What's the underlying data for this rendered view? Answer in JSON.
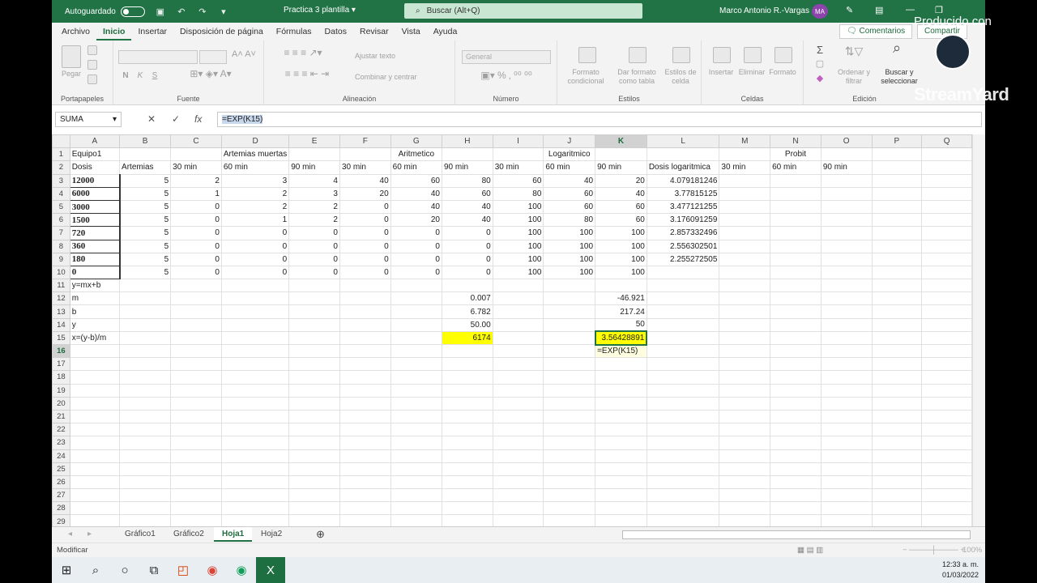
{
  "titlebar": {
    "autosave": "Autoguardado",
    "doc_title": "Practica 3 plantilla",
    "search": "Buscar (Alt+Q)",
    "user": "Marco Antonio R.-Vargas",
    "initials": "MA"
  },
  "menu": [
    "Archivo",
    "Inicio",
    "Insertar",
    "Disposición de página",
    "Fórmulas",
    "Datos",
    "Revisar",
    "Vista",
    "Ayuda"
  ],
  "menu_active": "Inicio",
  "comments": "Comentarios",
  "share": "Compartir",
  "ribbon": {
    "clipboard": {
      "label": "Portapapeles",
      "paste": "Pegar"
    },
    "font": {
      "label": "Fuente",
      "bold": "N",
      "italic": "K",
      "underline": "S"
    },
    "align": {
      "label": "Alineación",
      "wrap": "Ajustar texto",
      "merge": "Combinar y centrar"
    },
    "number": {
      "label": "Número",
      "format": "General"
    },
    "styles": {
      "label": "Estilos",
      "cond": "Formato condicional",
      "table": "Dar formato como tabla",
      "cell": "Estilos de celda"
    },
    "cells": {
      "label": "Celdas",
      "insert": "Insertar",
      "delete": "Eliminar",
      "format": "Formato"
    },
    "editing": {
      "label": "Edición",
      "sort": "Ordenar y filtrar",
      "find": "Buscar y seleccionar"
    }
  },
  "formula_bar": {
    "namebox": "SUMA",
    "formula": "=EXP(K15)"
  },
  "columns": [
    "A",
    "B",
    "C",
    "D",
    "E",
    "F",
    "G",
    "H",
    "I",
    "J",
    "K",
    "L",
    "M",
    "N",
    "O",
    "P",
    "Q"
  ],
  "rows": [
    [
      "Equipo1",
      "",
      "",
      "Artemias muertas",
      "",
      "",
      "Aritmetico",
      "",
      "",
      "Logaritmico",
      "",
      "",
      "",
      "Probit",
      "",
      "",
      ""
    ],
    [
      "Dosis",
      "Artemias",
      "30 min",
      "60 min",
      "90 min",
      "30 min",
      "60 min",
      "90 min",
      "30 min",
      "60 min",
      "90 min",
      "Dosis logaritmica",
      "30 min",
      "60 min",
      "90 min",
      "",
      ""
    ],
    [
      "12000",
      "5",
      "2",
      "3",
      "4",
      "40",
      "60",
      "80",
      "60",
      "40",
      "20",
      "4.079181246",
      "",
      "",
      "",
      "",
      ""
    ],
    [
      "6000",
      "5",
      "1",
      "2",
      "3",
      "20",
      "40",
      "60",
      "80",
      "60",
      "40",
      "3.77815125",
      "",
      "",
      "",
      "",
      ""
    ],
    [
      "3000",
      "5",
      "0",
      "2",
      "2",
      "0",
      "40",
      "40",
      "100",
      "60",
      "60",
      "3.477121255",
      "",
      "",
      "",
      "",
      ""
    ],
    [
      "1500",
      "5",
      "0",
      "1",
      "2",
      "0",
      "20",
      "40",
      "100",
      "80",
      "60",
      "3.176091259",
      "",
      "",
      "",
      "",
      ""
    ],
    [
      "720",
      "5",
      "0",
      "0",
      "0",
      "0",
      "0",
      "0",
      "100",
      "100",
      "100",
      "2.857332496",
      "",
      "",
      "",
      "",
      ""
    ],
    [
      "360",
      "5",
      "0",
      "0",
      "0",
      "0",
      "0",
      "0",
      "100",
      "100",
      "100",
      "2.556302501",
      "",
      "",
      "",
      "",
      ""
    ],
    [
      "180",
      "5",
      "0",
      "0",
      "0",
      "0",
      "0",
      "0",
      "100",
      "100",
      "100",
      "2.255272505",
      "",
      "",
      "",
      "",
      ""
    ],
    [
      "0",
      "5",
      "0",
      "0",
      "0",
      "0",
      "0",
      "0",
      "100",
      "100",
      "100",
      "",
      "",
      "",
      "",
      "",
      ""
    ],
    [
      "y=mx+b",
      "",
      "",
      "",
      "",
      "",
      "",
      "",
      "",
      "",
      "",
      "",
      "",
      "",
      "",
      "",
      ""
    ],
    [
      "m",
      "",
      "",
      "",
      "",
      "",
      "",
      "0.007",
      "",
      "",
      "-46.921",
      "",
      "",
      "",
      "",
      "",
      ""
    ],
    [
      "b",
      "",
      "",
      "",
      "",
      "",
      "",
      "6.782",
      "",
      "",
      "217.24",
      "",
      "",
      "",
      "",
      "",
      ""
    ],
    [
      "y",
      "",
      "",
      "",
      "",
      "",
      "",
      "50.00",
      "",
      "",
      "50",
      "",
      "",
      "",
      "",
      "",
      ""
    ],
    [
      "x=(y-b)/m",
      "",
      "",
      "",
      "",
      "",
      "",
      "6174",
      "",
      "",
      "3.56428891",
      "",
      "",
      "",
      "",
      "",
      ""
    ],
    [
      "",
      "",
      "",
      "",
      "",
      "",
      "",
      "",
      "",
      "",
      "=EXP(K15)",
      "",
      "",
      "",
      "",
      "",
      ""
    ],
    [
      "",
      "",
      "",
      "",
      "",
      "",
      "",
      "",
      "",
      "",
      "",
      "",
      "",
      "",
      "",
      "",
      ""
    ],
    [
      "",
      "",
      "",
      "",
      "",
      "",
      "",
      "",
      "",
      "",
      "",
      "",
      "",
      "",
      "",
      "",
      ""
    ],
    [
      "",
      "",
      "",
      "",
      "",
      "",
      "",
      "",
      "",
      "",
      "",
      "",
      "",
      "",
      "",
      "",
      ""
    ],
    [
      "",
      "",
      "",
      "",
      "",
      "",
      "",
      "",
      "",
      "",
      "",
      "",
      "",
      "",
      "",
      "",
      ""
    ],
    [
      "",
      "",
      "",
      "",
      "",
      "",
      "",
      "",
      "",
      "",
      "",
      "",
      "",
      "",
      "",
      "",
      ""
    ],
    [
      "",
      "",
      "",
      "",
      "",
      "",
      "",
      "",
      "",
      "",
      "",
      "",
      "",
      "",
      "",
      "",
      ""
    ],
    [
      "",
      "",
      "",
      "",
      "",
      "",
      "",
      "",
      "",
      "",
      "",
      "",
      "",
      "",
      "",
      "",
      ""
    ],
    [
      "",
      "",
      "",
      "",
      "",
      "",
      "",
      "",
      "",
      "",
      "",
      "",
      "",
      "",
      "",
      "",
      ""
    ],
    [
      "",
      "",
      "",
      "",
      "",
      "",
      "",
      "",
      "",
      "",
      "",
      "",
      "",
      "",
      "",
      "",
      ""
    ],
    [
      "",
      "",
      "",
      "",
      "",
      "",
      "",
      "",
      "",
      "",
      "",
      "",
      "",
      "",
      "",
      "",
      ""
    ],
    [
      "",
      "",
      "",
      "",
      "",
      "",
      "",
      "",
      "",
      "",
      "",
      "",
      "",
      "",
      "",
      "",
      ""
    ],
    [
      "",
      "",
      "",
      "",
      "",
      "",
      "",
      "",
      "",
      "",
      "",
      "",
      "",
      "",
      "",
      "",
      ""
    ],
    [
      "",
      "",
      "",
      "",
      "",
      "",
      "",
      "",
      "",
      "",
      "",
      "",
      "",
      "",
      "",
      "",
      ""
    ]
  ],
  "sheets": [
    "Gráfico1",
    "Gráfico2",
    "Hoja1",
    "Hoja2"
  ],
  "active_sheet": "Hoja1",
  "status": "Modificar",
  "zoom": "100%",
  "clock": {
    "time": "12:33 a. m.",
    "date": "01/03/2022"
  },
  "watermark": {
    "top": "Producido con",
    "brand": "StreamYard"
  }
}
